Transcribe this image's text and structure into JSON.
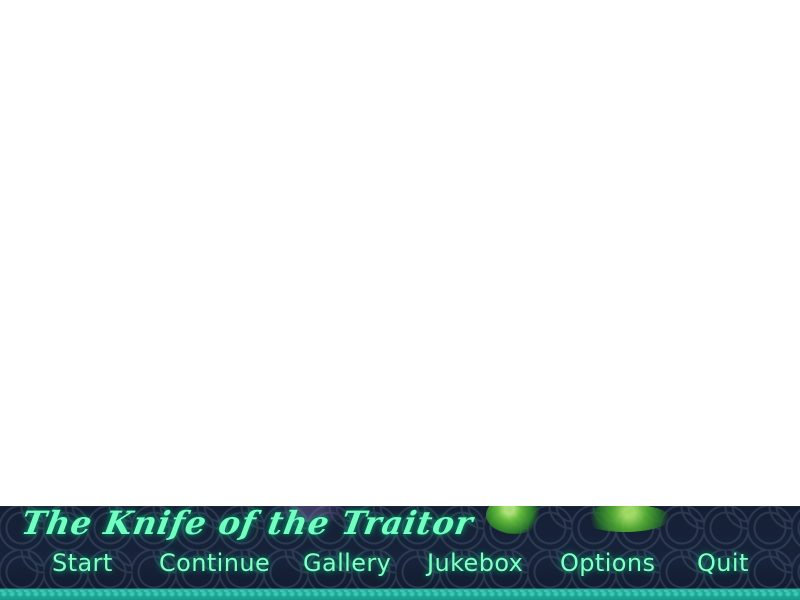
{
  "game": {
    "title": "The Knife of the Traitor"
  },
  "menu": {
    "items": [
      {
        "label": "Start"
      },
      {
        "label": "Continue"
      },
      {
        "label": "Gallery"
      },
      {
        "label": "Jukebox"
      },
      {
        "label": "Options"
      },
      {
        "label": "Quit"
      }
    ]
  },
  "colors": {
    "accent": "#84ffc8",
    "panel": "#17233a",
    "trim": "#22b6a2"
  }
}
